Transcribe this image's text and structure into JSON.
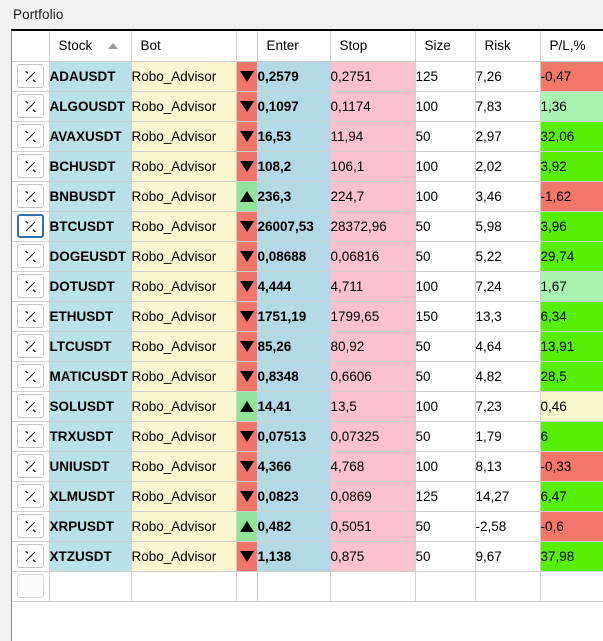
{
  "window": {
    "title": "Portfolio"
  },
  "table": {
    "columns": [
      {
        "key": "action",
        "label": ""
      },
      {
        "key": "stock",
        "label": "Stock",
        "sort": "asc"
      },
      {
        "key": "bot",
        "label": "Bot"
      },
      {
        "key": "dir",
        "label": ""
      },
      {
        "key": "enter",
        "label": "Enter"
      },
      {
        "key": "stop",
        "label": "Stop"
      },
      {
        "key": "size",
        "label": "Size"
      },
      {
        "key": "risk",
        "label": "Risk"
      },
      {
        "key": "pl",
        "label": "P/L,%"
      }
    ],
    "row_action_icon": "crossed-tools-icon",
    "rows": [
      {
        "stock": "ADAUSDT",
        "bot": "Robo_Advisor",
        "dir": "down",
        "enter": "0,2579",
        "stop": "0,2751",
        "size": "125",
        "risk": "7,26",
        "pl": "-0,47",
        "pl_color": "#f4776b",
        "focused": false
      },
      {
        "stock": "ALGOUSDT",
        "bot": "Robo_Advisor",
        "dir": "down",
        "enter": "0,1097",
        "stop": "0,1174",
        "size": "100",
        "risk": "7,83",
        "pl": "1,36",
        "pl_color": "#a9f4b1",
        "focused": false
      },
      {
        "stock": "AVAXUSDT",
        "bot": "Robo_Advisor",
        "dir": "down",
        "enter": "16,53",
        "stop": "11,94",
        "size": "50",
        "risk": "2,97",
        "pl": "32,06",
        "pl_color": "#57ef06",
        "focused": false
      },
      {
        "stock": "BCHUSDT",
        "bot": "Robo_Advisor",
        "dir": "down",
        "enter": "108,2",
        "stop": "106,1",
        "size": "100",
        "risk": "2,02",
        "pl": "3,92",
        "pl_color": "#57ef06",
        "focused": false
      },
      {
        "stock": "BNBUSDT",
        "bot": "Robo_Advisor",
        "dir": "up",
        "enter": "236,3",
        "stop": "224,7",
        "size": "100",
        "risk": "3,46",
        "pl": "-1,62",
        "pl_color": "#f4776b",
        "focused": false
      },
      {
        "stock": "BTCUSDT",
        "bot": "Robo_Advisor",
        "dir": "down",
        "enter": "26007,53",
        "stop": "28372,96",
        "size": "50",
        "risk": "5,98",
        "pl": "3,96",
        "pl_color": "#57ef06",
        "focused": true
      },
      {
        "stock": "DOGEUSDT",
        "bot": "Robo_Advisor",
        "dir": "down",
        "enter": "0,08688",
        "stop": "0,06816",
        "size": "50",
        "risk": "5,22",
        "pl": "29,74",
        "pl_color": "#57ef06",
        "focused": false
      },
      {
        "stock": "DOTUSDT",
        "bot": "Robo_Advisor",
        "dir": "down",
        "enter": "4,444",
        "stop": "4,711",
        "size": "100",
        "risk": "7,24",
        "pl": "1,67",
        "pl_color": "#a9f4b1",
        "focused": false
      },
      {
        "stock": "ETHUSDT",
        "bot": "Robo_Advisor",
        "dir": "down",
        "enter": "1751,19",
        "stop": "1799,65",
        "size": "150",
        "risk": "13,3",
        "pl": "6,34",
        "pl_color": "#57ef06",
        "focused": false
      },
      {
        "stock": "LTCUSDT",
        "bot": "Robo_Advisor",
        "dir": "down",
        "enter": "85,26",
        "stop": "80,92",
        "size": "50",
        "risk": "4,64",
        "pl": "13,91",
        "pl_color": "#57ef06",
        "focused": false
      },
      {
        "stock": "MATICUSDT",
        "bot": "Robo_Advisor",
        "dir": "down",
        "enter": "0,8348",
        "stop": "0,6606",
        "size": "50",
        "risk": "4,82",
        "pl": "28,5",
        "pl_color": "#57ef06",
        "focused": false
      },
      {
        "stock": "SOLUSDT",
        "bot": "Robo_Advisor",
        "dir": "up",
        "enter": "14,41",
        "stop": "13,5",
        "size": "100",
        "risk": "7,23",
        "pl": "0,46",
        "pl_color": "#f7f6cf",
        "focused": false
      },
      {
        "stock": "TRXUSDT",
        "bot": "Robo_Advisor",
        "dir": "down",
        "enter": "0,07513",
        "stop": "0,07325",
        "size": "50",
        "risk": "1,79",
        "pl": "6",
        "pl_color": "#57ef06",
        "focused": false
      },
      {
        "stock": "UNIUSDT",
        "bot": "Robo_Advisor",
        "dir": "down",
        "enter": "4,366",
        "stop": "4,768",
        "size": "100",
        "risk": "8,13",
        "pl": "-0,33",
        "pl_color": "#f4776b",
        "focused": false
      },
      {
        "stock": "XLMUSDT",
        "bot": "Robo_Advisor",
        "dir": "down",
        "enter": "0,0823",
        "stop": "0,0869",
        "size": "125",
        "risk": "14,27",
        "pl": "6,47",
        "pl_color": "#57ef06",
        "focused": false
      },
      {
        "stock": "XRPUSDT",
        "bot": "Robo_Advisor",
        "dir": "up",
        "enter": "0,482",
        "stop": "0,5051",
        "size": "50",
        "risk": "-2,58",
        "pl": "-0,6",
        "pl_color": "#f4776b",
        "focused": false
      },
      {
        "stock": "XTZUSDT",
        "bot": "Robo_Advisor",
        "dir": "down",
        "enter": "1,138",
        "stop": "0,875",
        "size": "50",
        "risk": "9,67",
        "pl": "37,98",
        "pl_color": "#57ef06",
        "focused": false
      }
    ],
    "has_trailing_empty_row": true
  },
  "colors": {
    "stock_bg": "#b9e1e8",
    "bot_bg": "#f7f6cf",
    "enter_bg": "#b4d9e6",
    "stop_bg": "#f9c2cc",
    "dir_down_bg": "#f2756a",
    "dir_up_bg": "#8ee396",
    "pl_positive_strong": "#57ef06",
    "pl_positive_weak": "#a9f4b1",
    "pl_negative": "#f4776b",
    "pl_neutral": "#f7f6cf",
    "focus_border": "#2f6fb5"
  }
}
